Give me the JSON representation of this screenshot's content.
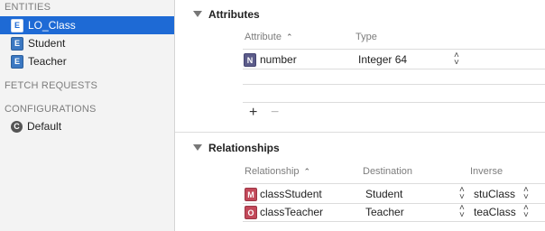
{
  "sidebar": {
    "entities_header": "ENTITIES",
    "entities": [
      {
        "badge": "E",
        "label": "LO_Class",
        "selected": true
      },
      {
        "badge": "E",
        "label": "Student",
        "selected": false
      },
      {
        "badge": "E",
        "label": "Teacher",
        "selected": false
      }
    ],
    "fetch_header": "FETCH REQUESTS",
    "config_header": "CONFIGURATIONS",
    "configurations": [
      {
        "badge": "C",
        "label": "Default"
      }
    ]
  },
  "attributes": {
    "title": "Attributes",
    "col_attribute": "Attribute",
    "col_type": "Type",
    "rows": [
      {
        "badge": "N",
        "name": "number",
        "type": "Integer 64"
      }
    ],
    "add": "+",
    "remove": "−"
  },
  "relationships": {
    "title": "Relationships",
    "col_relationship": "Relationship",
    "col_destination": "Destination",
    "col_inverse": "Inverse",
    "rows": [
      {
        "badge": "M",
        "name": "classStudent",
        "destination": "Student",
        "inverse": "stuClass"
      },
      {
        "badge": "O",
        "name": "classTeacher",
        "destination": "Teacher",
        "inverse": "teaClass"
      }
    ]
  },
  "colors": {
    "selection": "#1e6ad5",
    "entity_badge": "#3b78c2",
    "attribute_badge": "#5c5c8a",
    "relationship_badge": "#c2495a"
  },
  "icons": {
    "sort": "chevron-up-icon",
    "stepper": "up-down-stepper-icon",
    "disclosure": "disclosure-triangle-icon"
  }
}
